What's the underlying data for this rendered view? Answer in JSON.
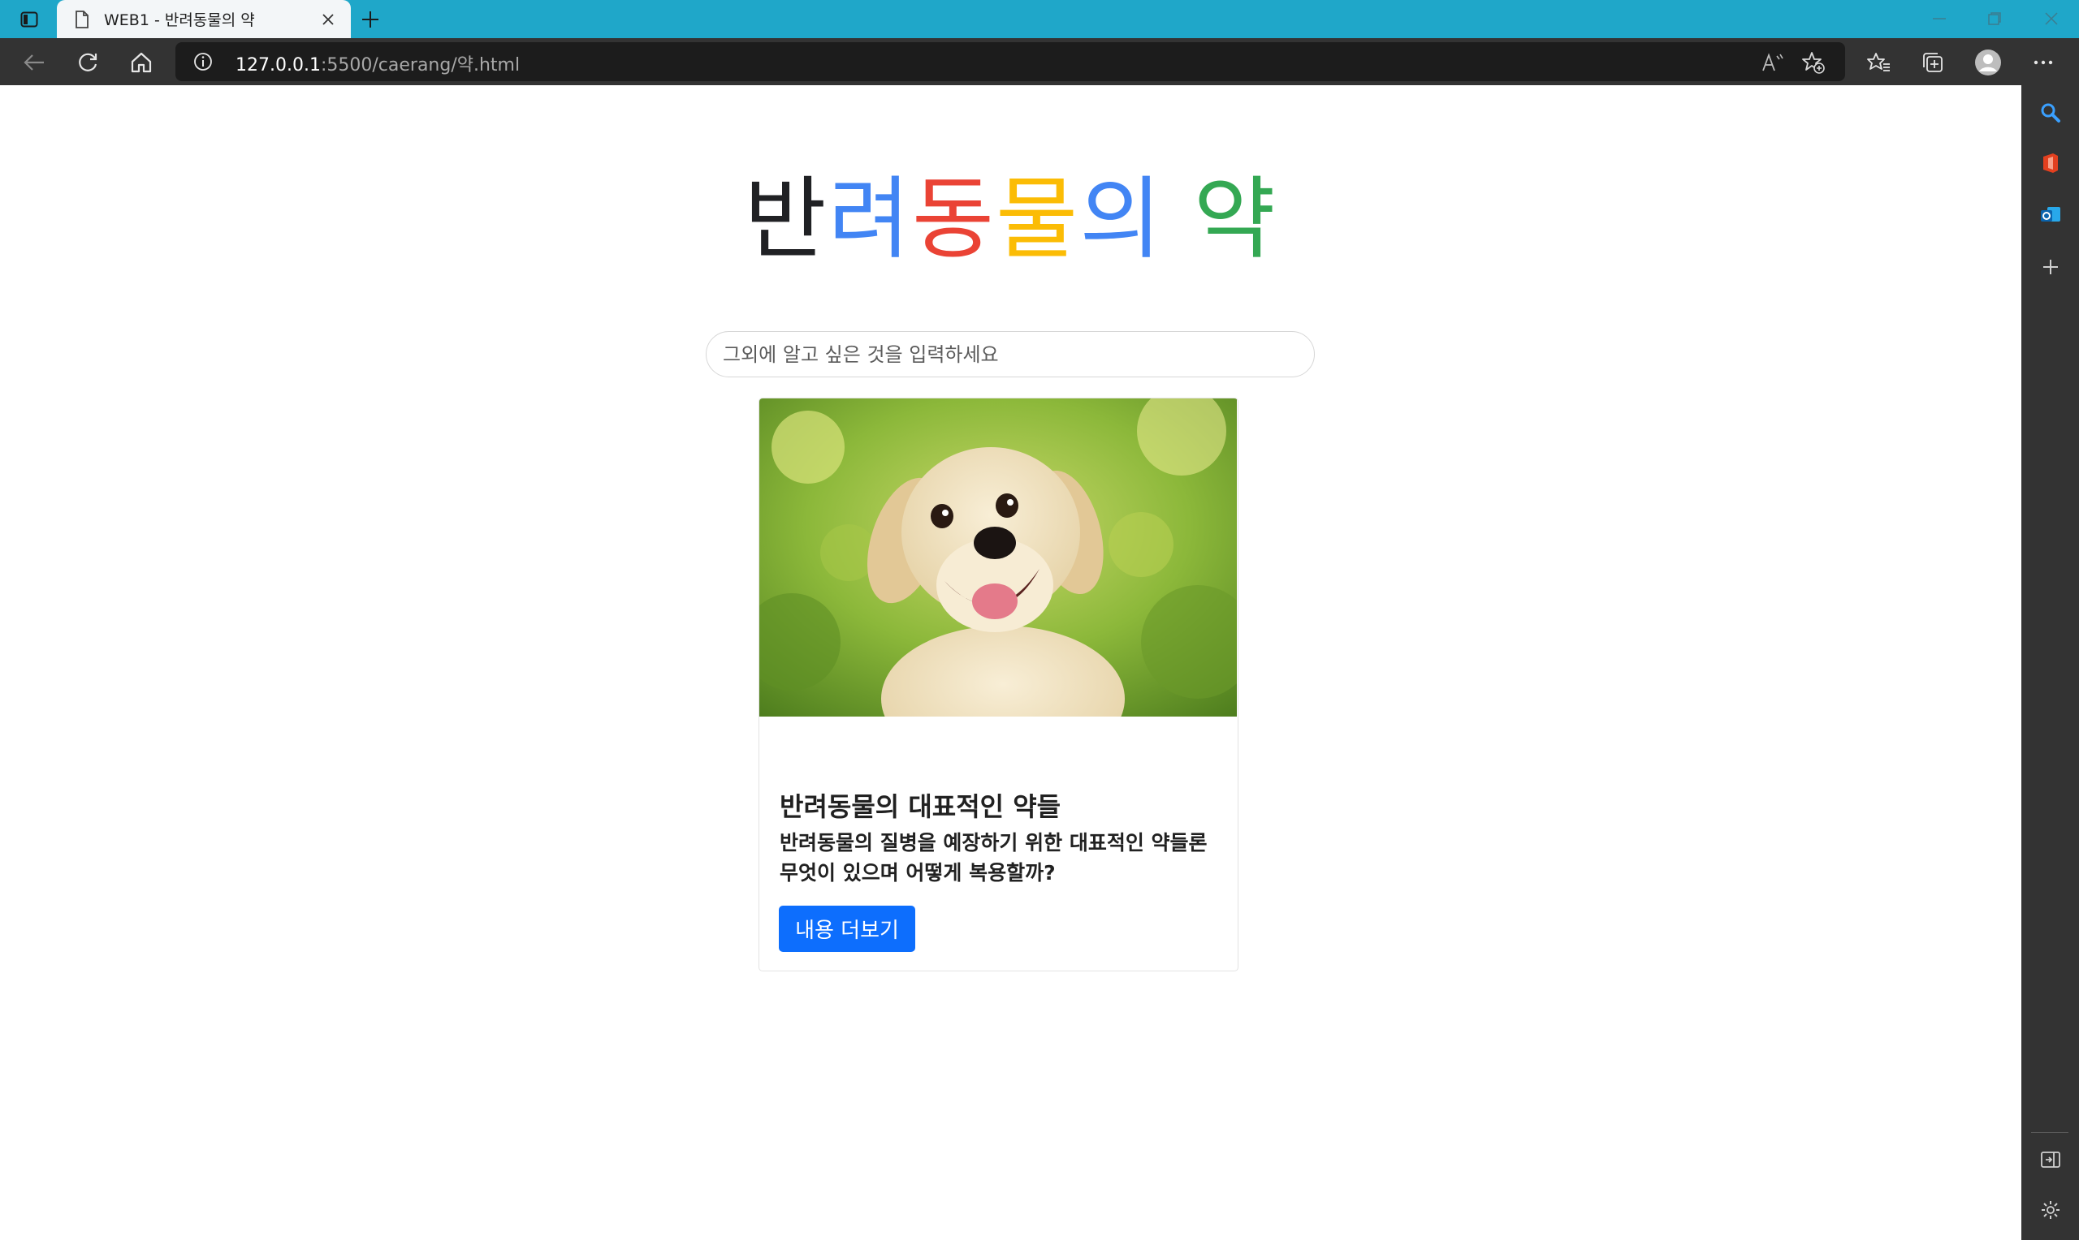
{
  "browser": {
    "tab": {
      "title": "WEB1 - 반려동물의 약"
    },
    "address": {
      "host": "127.0.0.1",
      "path": ":5500/caerang/약.html"
    }
  },
  "page": {
    "hero": {
      "chars": [
        {
          "text": "반",
          "color": "#202124"
        },
        {
          "text": "려",
          "color": "#4285f4"
        },
        {
          "text": "동",
          "color": "#ea4335"
        },
        {
          "text": "물",
          "color": "#fbbc05"
        },
        {
          "text": "의",
          "color": "#4285f4"
        },
        {
          "text": " ",
          "color": "#202124"
        },
        {
          "text": "약",
          "color": "#34a853"
        }
      ]
    },
    "search": {
      "placeholder": "그외에 알고 싶은 것을 입력하세요"
    },
    "card": {
      "title": "반려동물의 대표적인 약들",
      "text": "반려동물의 질병을 예장하기 위한 대표적인 약들론 무엇이 있으며 어떻게 복용할까?",
      "button_label": "내용 더보기"
    }
  },
  "colors": {
    "titlebar": "#1fa7c9",
    "toolbar": "#333333",
    "button": "#0d6efd"
  }
}
